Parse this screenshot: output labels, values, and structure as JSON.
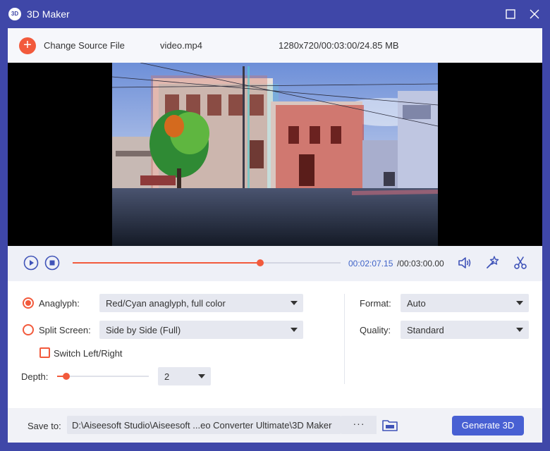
{
  "app": {
    "title": "3D Maker",
    "logo_text": "3D"
  },
  "topbar": {
    "change_source_label": "Change Source File",
    "file_name": "video.mp4",
    "file_info": "1280x720/00:03:00/24.85 MB"
  },
  "playback": {
    "current_time": "00:02:07.15",
    "total_time": "/00:03:00.00",
    "progress": 0.7
  },
  "settings": {
    "anaglyph": {
      "label": "Anaglyph:",
      "selected": true,
      "value": "Red/Cyan anaglyph, full color"
    },
    "split_screen": {
      "label": "Split Screen:",
      "selected": false,
      "value": "Side by Side (Full)"
    },
    "switch_lr": {
      "label": "Switch Left/Right",
      "checked": false
    },
    "depth": {
      "label": "Depth:",
      "value": "2",
      "level": 0.1
    },
    "format": {
      "label": "Format:",
      "value": "Auto"
    },
    "quality": {
      "label": "Quality:",
      "value": "Standard"
    }
  },
  "save": {
    "label": "Save to:",
    "path": "D:\\Aiseesoft Studio\\Aiseesoft ...eo Converter Ultimate\\3D Maker",
    "browse_label": "···",
    "generate_label": "Generate 3D"
  },
  "colors": {
    "accent": "#f25a3c",
    "primary": "#4860d3",
    "titlebar": "#3f47a8",
    "time": "#3f63c8"
  },
  "icons": [
    "app-logo-icon",
    "maximize-icon",
    "close-icon",
    "add-icon",
    "play-icon",
    "stop-icon",
    "volume-icon",
    "magic-wand-icon",
    "scissors-icon",
    "folder-icon"
  ]
}
